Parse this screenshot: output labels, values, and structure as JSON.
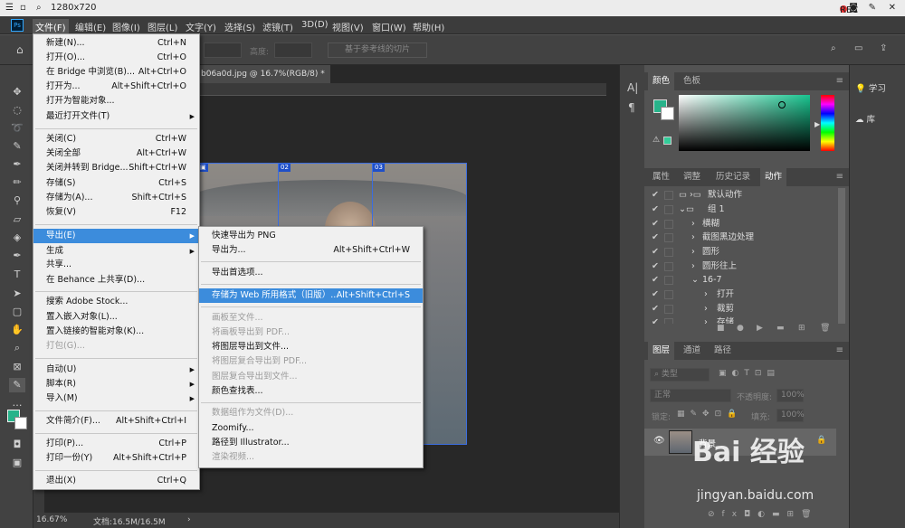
{
  "os_bar": {
    "title": "1280x720",
    "rec_label": "REC"
  },
  "menubar": {
    "items": [
      "文件(F)",
      "编辑(E)",
      "图像(I)",
      "图层(L)",
      "文字(Y)",
      "选择(S)",
      "滤镜(T)",
      "3D(D)",
      "视图(V)",
      "窗口(W)",
      "帮助(H)"
    ],
    "logo": "Ps"
  },
  "options_bar": {
    "height_label": "高度:",
    "slice_button": "基于参考线的切片"
  },
  "document": {
    "tab_title": "b06a0d.jpg @ 16.7%(RGB/8) *",
    "slice_tags": [
      "02",
      "03"
    ]
  },
  "status_bar": {
    "zoom": "16.67%",
    "doc_info": "文档:16.5M/16.5M"
  },
  "file_menu": {
    "items": [
      {
        "label": "新建(N)...",
        "shortcut": "Ctrl+N"
      },
      {
        "label": "打开(O)...",
        "shortcut": "Ctrl+O"
      },
      {
        "label": "在 Bridge 中浏览(B)...",
        "shortcut": "Alt+Ctrl+O"
      },
      {
        "label": "打开为...",
        "shortcut": "Alt+Shift+Ctrl+O"
      },
      {
        "label": "打开为智能对象...",
        "shortcut": ""
      },
      {
        "label": "最近打开文件(T)",
        "shortcut": "",
        "submenu": true
      },
      {
        "label": "关闭(C)",
        "shortcut": "Ctrl+W"
      },
      {
        "label": "关闭全部",
        "shortcut": "Alt+Ctrl+W"
      },
      {
        "label": "关闭并转到 Bridge...",
        "shortcut": "Shift+Ctrl+W"
      },
      {
        "label": "存储(S)",
        "shortcut": "Ctrl+S"
      },
      {
        "label": "存储为(A)...",
        "shortcut": "Shift+Ctrl+S"
      },
      {
        "label": "恢复(V)",
        "shortcut": "F12"
      },
      {
        "label": "导出(E)",
        "shortcut": "",
        "submenu": true,
        "highlighted": true
      },
      {
        "label": "生成",
        "shortcut": "",
        "submenu": true
      },
      {
        "label": "共享...",
        "shortcut": ""
      },
      {
        "label": "在 Behance 上共享(D)...",
        "shortcut": ""
      },
      {
        "label": "搜索 Adobe Stock...",
        "shortcut": ""
      },
      {
        "label": "置入嵌入对象(L)...",
        "shortcut": ""
      },
      {
        "label": "置入链接的智能对象(K)...",
        "shortcut": ""
      },
      {
        "label": "打包(G)...",
        "shortcut": "",
        "disabled": true
      },
      {
        "label": "自动(U)",
        "shortcut": "",
        "submenu": true
      },
      {
        "label": "脚本(R)",
        "shortcut": "",
        "submenu": true
      },
      {
        "label": "导入(M)",
        "shortcut": "",
        "submenu": true
      },
      {
        "label": "文件简介(F)...",
        "shortcut": "Alt+Shift+Ctrl+I"
      },
      {
        "label": "打印(P)...",
        "shortcut": "Ctrl+P"
      },
      {
        "label": "打印一份(Y)",
        "shortcut": "Alt+Shift+Ctrl+P"
      },
      {
        "label": "退出(X)",
        "shortcut": "Ctrl+Q"
      }
    ]
  },
  "export_menu": {
    "items": [
      {
        "label": "快速导出为 PNG",
        "shortcut": ""
      },
      {
        "label": "导出为...",
        "shortcut": "Alt+Shift+Ctrl+W"
      },
      {
        "label": "导出首选项...",
        "shortcut": ""
      },
      {
        "label": "存储为 Web 所用格式（旧版）...",
        "shortcut": "Alt+Shift+Ctrl+S",
        "highlighted": true
      },
      {
        "label": "画板至文件...",
        "shortcut": "",
        "disabled": true
      },
      {
        "label": "将画板导出到 PDF...",
        "shortcut": "",
        "disabled": true
      },
      {
        "label": "将图层导出到文件...",
        "shortcut": ""
      },
      {
        "label": "将图层复合导出到 PDF...",
        "shortcut": "",
        "disabled": true
      },
      {
        "label": "图层复合导出到文件...",
        "shortcut": "",
        "disabled": true
      },
      {
        "label": "颜色查找表...",
        "shortcut": ""
      },
      {
        "label": "数据组作为文件(D)...",
        "shortcut": "",
        "disabled": true
      },
      {
        "label": "Zoomify...",
        "shortcut": ""
      },
      {
        "label": "路径到 Illustrator...",
        "shortcut": ""
      },
      {
        "label": "渲染视频...",
        "shortcut": "",
        "disabled": true
      }
    ]
  },
  "color_panel": {
    "tabs": [
      "颜色",
      "色板"
    ],
    "fg_color": "#27b38a",
    "bg_color": "#ffffff"
  },
  "actions_panel": {
    "tabs": [
      "属性",
      "调整",
      "历史记录",
      "动作"
    ],
    "rows": [
      "默认动作",
      "组 1",
      "横糊",
      "截图黑边处理",
      "圆形",
      "圆形往上",
      "16-7",
      "打开",
      "裁剪",
      "存储"
    ]
  },
  "layers_panel": {
    "tabs": [
      "图层",
      "通道",
      "路径"
    ],
    "kind_label": "类型",
    "blend_mode": "正常",
    "opacity_label": "不透明度:",
    "opacity_value": "100%",
    "lock_label": "锁定:",
    "fill_label": "填充:",
    "fill_value": "100%",
    "layer_name": "背景"
  },
  "far_right": {
    "learn": "学习",
    "library": "库"
  },
  "watermark": {
    "brand": "Bai 经验",
    "url": "jingyan.baidu.com"
  }
}
